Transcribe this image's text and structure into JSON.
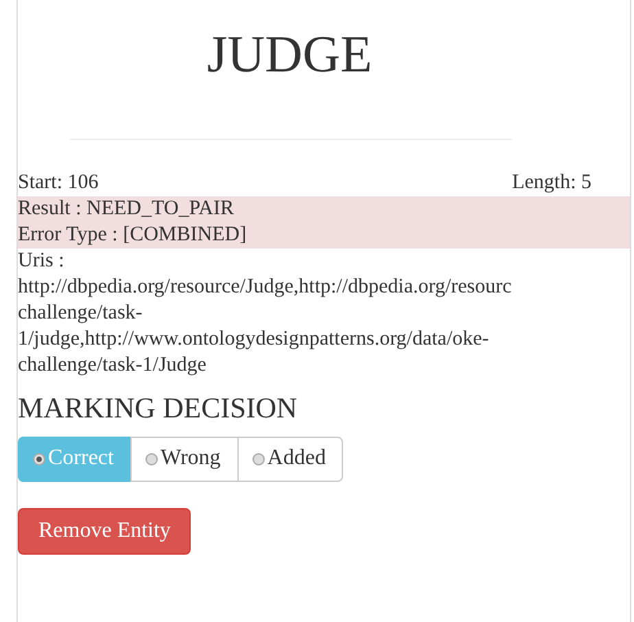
{
  "title": "JUDGE",
  "start": "Start: 106",
  "length": "Length: 5",
  "result": "Result : NEED_TO_PAIR",
  "error_type": "Error Type : [COMBINED]",
  "uris_label": "Uris :",
  "uris_lines": [
    "http://dbpedia.org/resource/Judge,http://dbpedia.org/resourc",
    "challenge/task-",
    "1/judge,http://www.ontologydesignpatterns.org/data/oke-",
    "challenge/task-1/Judge"
  ],
  "section_heading": "MARKING DECISION",
  "options": [
    {
      "label": "Correct",
      "selected": true
    },
    {
      "label": "Wrong",
      "selected": false
    },
    {
      "label": "Added",
      "selected": false
    }
  ],
  "remove_button": "Remove Entity"
}
